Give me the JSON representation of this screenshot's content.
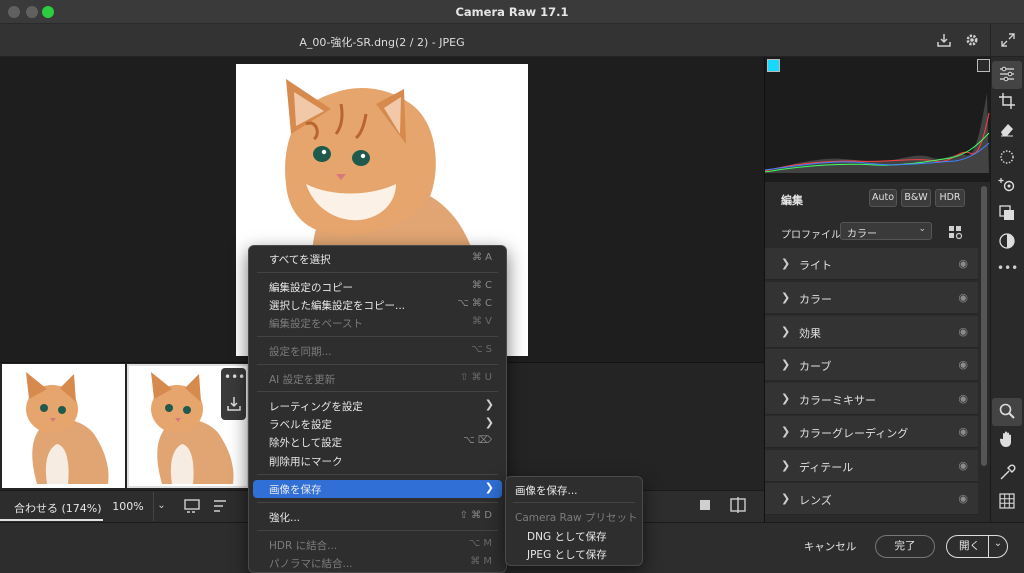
{
  "window": {
    "title": "Camera Raw 17.1",
    "file_title": "A_00-強化-SR.dng(2 / 2)  -  JPEG"
  },
  "histogram": {
    "clip_shadow_icon": "shadow-clip-warning",
    "clip_highlight_icon": "highlight-clip-warning"
  },
  "panel": {
    "edit_label": "編集",
    "auto_label": "Auto",
    "bw_label": "B&W",
    "hdr_label": "HDR",
    "profile_label": "プロファイル",
    "profile_value": "カラー",
    "sections": [
      "ライト",
      "カラー",
      "効果",
      "カーブ",
      "カラーミキサー",
      "カラーグレーディング",
      "ディテール",
      "レンズ"
    ]
  },
  "bottombar": {
    "fit_label": "合わせる (174%)",
    "zoom_label": "100%"
  },
  "context_menu": {
    "items": [
      {
        "label": "すべてを選択",
        "shortcut": "⌘ A",
        "disabled": false
      },
      {
        "label": "編集設定のコピー",
        "shortcut": "⌘ C",
        "disabled": false
      },
      {
        "label": "選択した編集設定をコピー...",
        "shortcut": "⌥ ⌘ C",
        "disabled": false
      },
      {
        "label": "編集設定をペースト",
        "shortcut": "⌘ V",
        "disabled": true
      },
      {
        "label": "設定を同期...",
        "shortcut": "⌥ S",
        "disabled": true
      },
      {
        "label": "AI 設定を更新",
        "shortcut": "⇧ ⌘ U",
        "disabled": true
      },
      {
        "label": "レーティングを設定",
        "shortcut": "",
        "disabled": false
      },
      {
        "label": "ラベルを設定",
        "shortcut": "",
        "disabled": false
      },
      {
        "label": "除外として設定",
        "shortcut": "⌥ ⌦",
        "disabled": false
      },
      {
        "label": "削除用にマーク",
        "shortcut": "",
        "disabled": false
      },
      {
        "label": "画像を保存",
        "shortcut": "",
        "disabled": false
      },
      {
        "label": "強化...",
        "shortcut": "⇧ ⌘ D",
        "disabled": false
      },
      {
        "label": "HDR に結合...",
        "shortcut": "⌥ M",
        "disabled": true
      },
      {
        "label": "パノラマに結合...",
        "shortcut": "⌘ M",
        "disabled": true
      }
    ]
  },
  "submenu": {
    "save_image": "画像を保存...",
    "preset_header": "Camera Raw プリセット",
    "dng": "DNG として保存",
    "jpeg": "JPEG として保存"
  },
  "footer": {
    "cancel_label": "キャンセル",
    "done_label": "完了",
    "open_label": "開く"
  },
  "colors": {
    "menu_highlight": "#2f6fd6",
    "accent_cyan": "#19d8ff"
  }
}
